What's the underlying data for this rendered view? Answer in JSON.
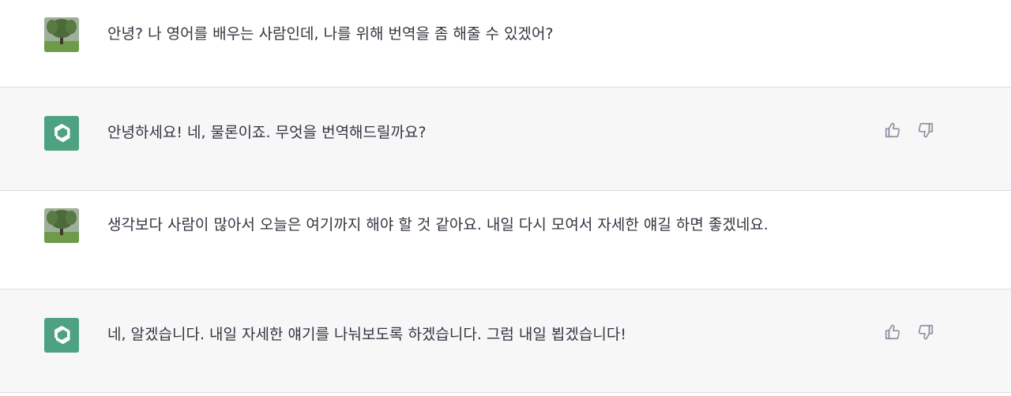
{
  "conversation": {
    "messages": [
      {
        "role": "user",
        "text": "안녕? 나 영어를 배우는 사람인데, 나를 위해 번역을 좀 해줄 수 있겠어?",
        "avatar_icon": "user-photo-avatar"
      },
      {
        "role": "assistant",
        "text": "안녕하세요! 네, 물론이죠. 무엇을 번역해드릴까요?",
        "avatar_icon": "openai-logo-icon",
        "actions": [
          "thumbs-up-icon",
          "thumbs-down-icon"
        ]
      },
      {
        "role": "user",
        "text": "생각보다 사람이 많아서 오늘은 여기까지 해야 할 것 같아요. 내일 다시 모여서 자세한 얘길 하면 좋겠네요.",
        "avatar_icon": "user-photo-avatar"
      },
      {
        "role": "assistant",
        "text": "네, 알겠습니다. 내일 자세한 얘기를 나눠보도록 하겠습니다. 그럼 내일 뵙겠습니다!",
        "avatar_icon": "openai-logo-icon",
        "actions": [
          "thumbs-up-icon",
          "thumbs-down-icon"
        ]
      }
    ]
  },
  "colors": {
    "assistant_bg": "#f7f7f8",
    "user_bg": "#ffffff",
    "assistant_avatar": "#4ea281",
    "text": "#343541",
    "icon": "#8e8ea0"
  }
}
